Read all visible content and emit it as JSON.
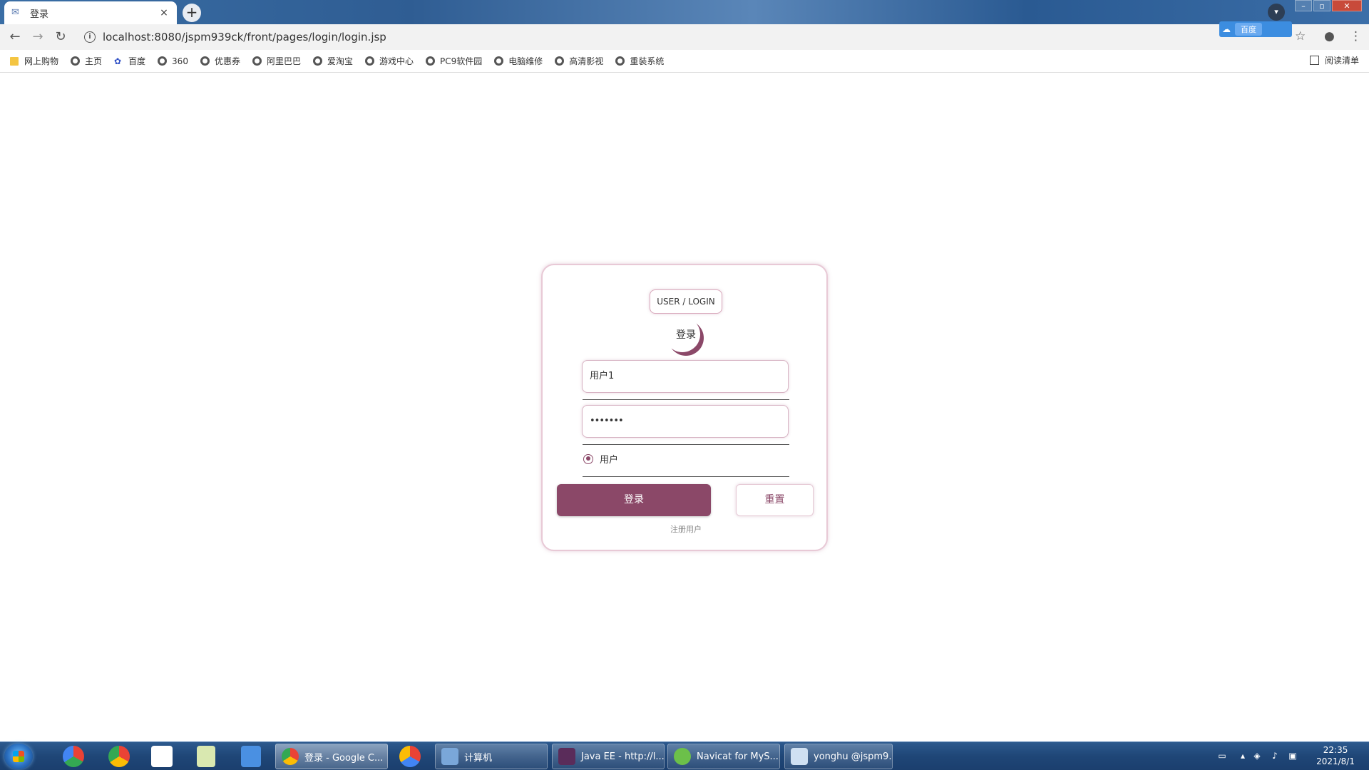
{
  "browser": {
    "tab_title": "登录",
    "tab_close": "×",
    "new_tab": "+",
    "url": "localhost:8080/jspm939ck/front/pages/login/login.jsp",
    "extension_label": "百度"
  },
  "bookmarks": [
    {
      "label": "网上购物",
      "icon": "folder"
    },
    {
      "label": "主页",
      "icon": "globe"
    },
    {
      "label": "百度",
      "icon": "paw"
    },
    {
      "label": "360",
      "icon": "globe"
    },
    {
      "label": "优惠券",
      "icon": "globe"
    },
    {
      "label": "阿里巴巴",
      "icon": "globe"
    },
    {
      "label": "爱淘宝",
      "icon": "globe"
    },
    {
      "label": "游戏中心",
      "icon": "globe"
    },
    {
      "label": "PC9软件园",
      "icon": "globe"
    },
    {
      "label": "电脑维修",
      "icon": "globe"
    },
    {
      "label": "高清影视",
      "icon": "globe"
    },
    {
      "label": "重装系统",
      "icon": "globe"
    }
  ],
  "reading_list": "阅读清单",
  "login": {
    "badge": "USER / LOGIN",
    "title": "登录",
    "username_value": "用户1",
    "password_value": "•••••••",
    "role_option": "用户",
    "login_button": "登录",
    "reset_button": "重置",
    "register_link": "注册用户",
    "accent_color": "#8b4868"
  },
  "taskbar": {
    "windows": [
      {
        "label": "登录 - Google C...",
        "active": true
      },
      {
        "label": "计算机",
        "active": false
      },
      {
        "label": "Java EE - http://l...",
        "active": false
      },
      {
        "label": "Navicat for MyS...",
        "active": false
      },
      {
        "label": "yonghu @jspm9...",
        "active": false
      }
    ],
    "time": "22:35",
    "date": "2021/8/1"
  }
}
